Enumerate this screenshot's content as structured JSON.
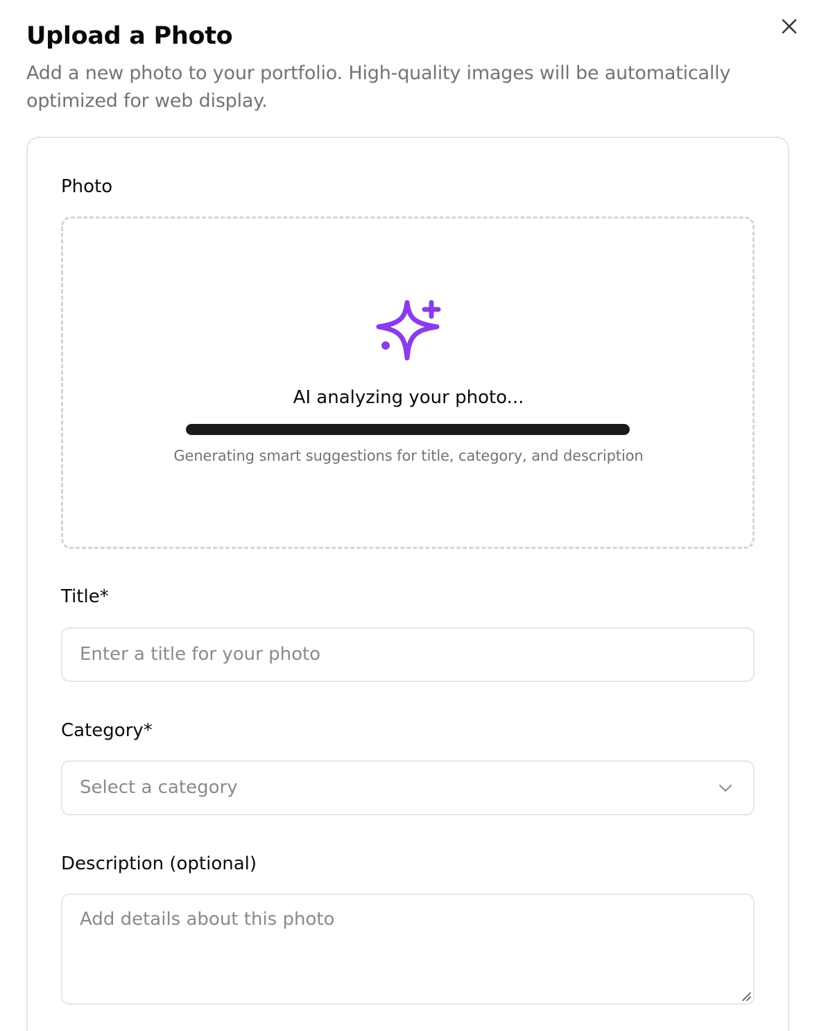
{
  "dialog": {
    "title": "Upload a Photo",
    "description": "Add a new photo to your portfolio. High-quality images will be automatically optimized for web display.",
    "close_icon": "close-icon"
  },
  "photo": {
    "label": "Photo",
    "icon": "sparkles-icon",
    "icon_color": "#8b3dea",
    "status_title": "AI analyzing your photo...",
    "status_subtitle": "Generating smart suggestions for title, category, and description",
    "progress": 1.0
  },
  "title_field": {
    "label": "Title*",
    "placeholder": "Enter a title for your photo",
    "value": ""
  },
  "category_field": {
    "label": "Category*",
    "placeholder": "Select a category",
    "icon": "chevron-down-icon"
  },
  "description_field": {
    "label": "Description (optional)",
    "placeholder": "Add details about this photo",
    "value": ""
  }
}
